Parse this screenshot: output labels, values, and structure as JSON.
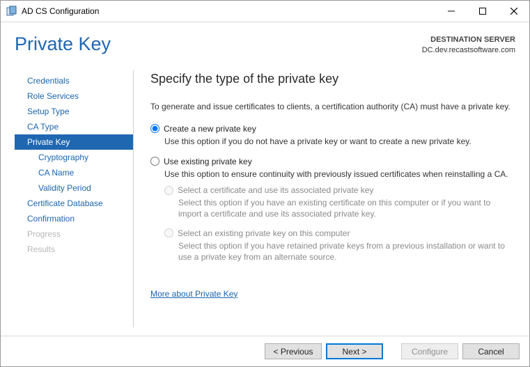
{
  "titlebar": {
    "title": "AD CS Configuration"
  },
  "header": {
    "page_title": "Private Key",
    "dest_label": "DESTINATION SERVER",
    "dest_server": "DC.dev.recastsoftware.com"
  },
  "sidebar": {
    "steps": [
      {
        "label": "Credentials"
      },
      {
        "label": "Role Services"
      },
      {
        "label": "Setup Type"
      },
      {
        "label": "CA Type"
      },
      {
        "label": "Private Key"
      },
      {
        "label": "Cryptography"
      },
      {
        "label": "CA Name"
      },
      {
        "label": "Validity Period"
      },
      {
        "label": "Certificate Database"
      },
      {
        "label": "Confirmation"
      },
      {
        "label": "Progress"
      },
      {
        "label": "Results"
      }
    ]
  },
  "main": {
    "heading": "Specify the type of the private key",
    "intro": "To generate and issue certificates to clients, a certification authority (CA) must have a private key.",
    "opt1_label": "Create a new private key",
    "opt1_desc": "Use this option if you do not have a private key or want to create a new private key.",
    "opt2_label": "Use existing private key",
    "opt2_desc": "Use this option to ensure continuity with previously issued certificates when reinstalling a CA.",
    "sub1_label": "Select a certificate and use its associated private key",
    "sub1_desc": "Select this option if you have an existing certificate on this computer or if you want to import a certificate and use its associated private key.",
    "sub2_label": "Select an existing private key on this computer",
    "sub2_desc": "Select this option if you have retained private keys from a previous installation or want to use a private key from an alternate source.",
    "more_link": "More about Private Key"
  },
  "footer": {
    "previous": "< Previous",
    "next": "Next >",
    "configure": "Configure",
    "cancel": "Cancel"
  }
}
